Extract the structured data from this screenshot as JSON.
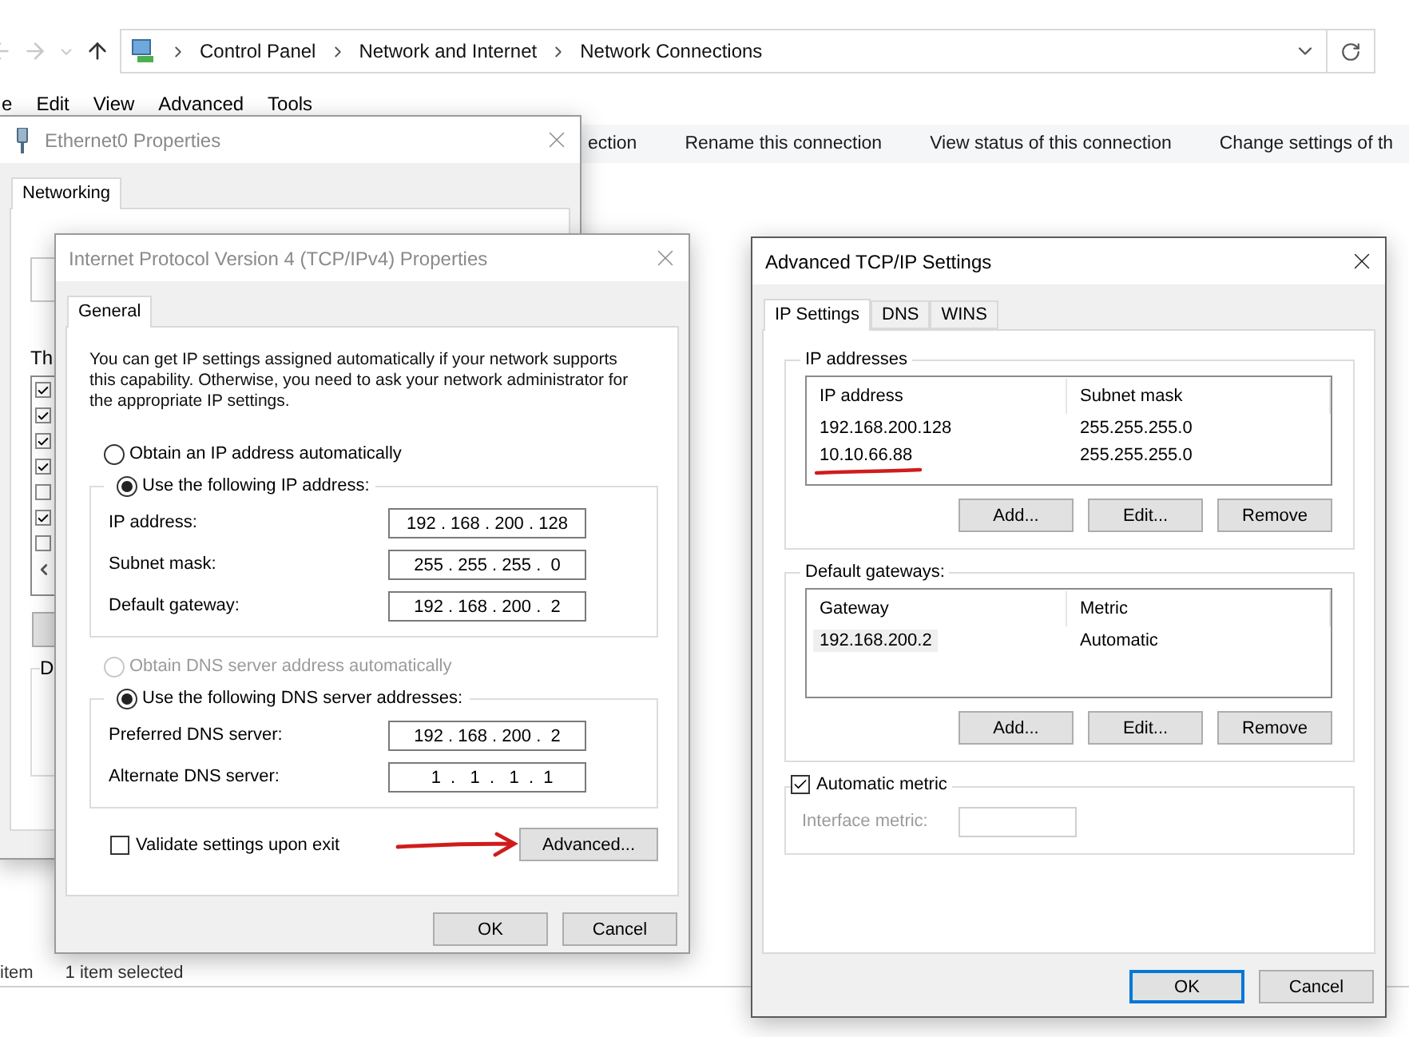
{
  "explorer": {
    "breadcrumbs": [
      "Control Panel",
      "Network and Internet",
      "Network Connections"
    ],
    "menu": [
      "e",
      "Edit",
      "View",
      "Advanced",
      "Tools"
    ],
    "commands": [
      "ection",
      "Rename this connection",
      "View status of this connection",
      "Change settings of th"
    ],
    "status_bar": [
      "item",
      "1 item selected"
    ]
  },
  "ethernet_dialog": {
    "title": "Ethernet0 Properties",
    "active": false,
    "tabs": [
      {
        "label": "Networking",
        "selected": true
      }
    ],
    "list_label": "Th",
    "components": [
      {
        "checked": true
      },
      {
        "checked": true
      },
      {
        "checked": true
      },
      {
        "checked": true
      },
      {
        "checked": false
      },
      {
        "checked": true
      },
      {
        "checked": false
      }
    ],
    "group_label": "D"
  },
  "ipv4_dialog": {
    "title": "Internet Protocol Version 4 (TCP/IPv4) Properties",
    "active": false,
    "tabs": [
      {
        "label": "General",
        "selected": true
      }
    ],
    "intro": "You can get IP settings assigned automatically if your network supports this capability. Otherwise, you need to ask your network administrator for the appropriate IP settings.",
    "ip_options": [
      {
        "label": "Obtain an IP address automatically",
        "selected": false,
        "disabled": false
      },
      {
        "label": "Use the following IP address:",
        "selected": true,
        "disabled": false
      }
    ],
    "ip_fields": [
      {
        "label": "IP address:",
        "value": "192 . 168 . 200 . 128"
      },
      {
        "label": "Subnet mask:",
        "value": "255 . 255 . 255 .  0"
      },
      {
        "label": "Default gateway:",
        "value": "192 . 168 . 200 .  2"
      }
    ],
    "dns_options": [
      {
        "label": "Obtain DNS server address automatically",
        "selected": false,
        "disabled": true
      },
      {
        "label": "Use the following DNS server addresses:",
        "selected": true,
        "disabled": false
      }
    ],
    "dns_fields": [
      {
        "label": "Preferred DNS server:",
        "value": "192 . 168 . 200 .  2"
      },
      {
        "label": "Alternate DNS server:",
        "value": "  1  .   1  .   1  .  1"
      }
    ],
    "validate": {
      "label": "Validate settings upon exit",
      "checked": false
    },
    "advanced_button": {
      "label": "Advanced...",
      "annotated": true
    },
    "buttons": [
      {
        "label": "OK",
        "default": false
      },
      {
        "label": "Cancel",
        "default": false
      }
    ]
  },
  "advanced_dialog": {
    "title": "Advanced TCP/IP Settings",
    "active": true,
    "tabs": [
      {
        "label": "IP Settings",
        "selected": true
      },
      {
        "label": "DNS",
        "selected": false
      },
      {
        "label": "WINS",
        "selected": false
      }
    ],
    "ip_addresses": {
      "title": "IP addresses",
      "columns": [
        "IP address",
        "Subnet mask"
      ],
      "rows": [
        {
          "cells": [
            "192.168.200.128",
            "255.255.255.0"
          ],
          "selected": false,
          "underlined": false
        },
        {
          "cells": [
            "10.10.66.88",
            "255.255.255.0"
          ],
          "selected": false,
          "underlined": true
        }
      ],
      "buttons": [
        "Add...",
        "Edit...",
        "Remove"
      ]
    },
    "gateways": {
      "title": "Default gateways:",
      "columns": [
        "Gateway",
        "Metric"
      ],
      "rows": [
        {
          "cells": [
            "192.168.200.2",
            "Automatic"
          ],
          "selected": true,
          "underlined": false
        }
      ],
      "buttons": [
        "Add...",
        "Edit...",
        "Remove"
      ]
    },
    "automatic_metric": {
      "label": "Automatic metric",
      "checked": true
    },
    "interface_metric": {
      "label": "Interface metric:",
      "disabled": true
    },
    "buttons": [
      {
        "label": "OK",
        "default": true
      },
      {
        "label": "Cancel",
        "default": false
      }
    ]
  }
}
